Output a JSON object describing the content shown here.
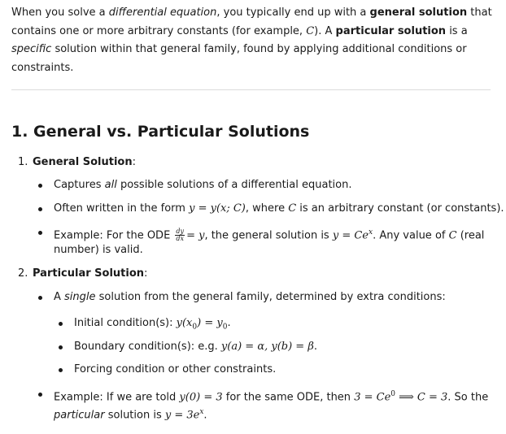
{
  "intro": {
    "t1": "When you solve a ",
    "t2": "differential equation",
    "t3": ", you typically end up with a ",
    "t4": "general solution",
    "t5": " that contains one or more arbitrary constants (for example, ",
    "t6": "C",
    "t7": "). A ",
    "t8": "particular solution",
    "t9": " is a ",
    "t10": "specific",
    "t11": " solution within that general family, found by applying additional conditions or constraints."
  },
  "section": {
    "title": "1. General vs. Particular Solutions"
  },
  "list": {
    "i1_num": "1.",
    "i1_label": "General Solution",
    "i1_colon": ":",
    "g1a": "Captures ",
    "g1b": "all",
    "g1c": " possible solutions of a differential equation.",
    "g2a": "Often written in the form ",
    "g2m": "y = y(x; C)",
    "g2b": ", where ",
    "g2c": "C",
    "g2d": " is an arbitrary constant (or constants).",
    "g3a": "Example: For the ODE ",
    "g3_num": "dy",
    "g3_den": "dx",
    "g3m": "= y",
    "g3b": ", the general solution is ",
    "g3m2": "y = Ce",
    "g3sup": "x",
    "g3c": ". Any value of ",
    "g3d": "C",
    "g3e": " (real",
    "g3f": "number) is valid.",
    "i2_num": "2.",
    "i2_label": "Particular Solution",
    "i2_colon": ":",
    "p1a": "A ",
    "p1b": "single",
    "p1c": " solution from the general family, determined by extra conditions:",
    "s1a": "Initial condition(s): ",
    "s1m": "y(x",
    "s1sub": "0",
    "s1m2": ") = y",
    "s1sub2": "0",
    "s1b": ".",
    "s2a": "Boundary condition(s): e.g. ",
    "s2m": "y(a) = α,  y(b) = β",
    "s2b": ".",
    "s3": "Forcing condition or other constraints.",
    "p2a": "Example: If we are told ",
    "p2m": "y(0) = 3",
    "p2b": " for the same ODE, then ",
    "p2m2": "3 = Ce",
    "p2sup": "0",
    "p2m3": " ⟹ C = 3",
    "p2c": ". So the",
    "p2d": "particular",
    "p2e": " solution is ",
    "p2m4": "y = 3e",
    "p2sup2": "x",
    "p2f": "."
  }
}
